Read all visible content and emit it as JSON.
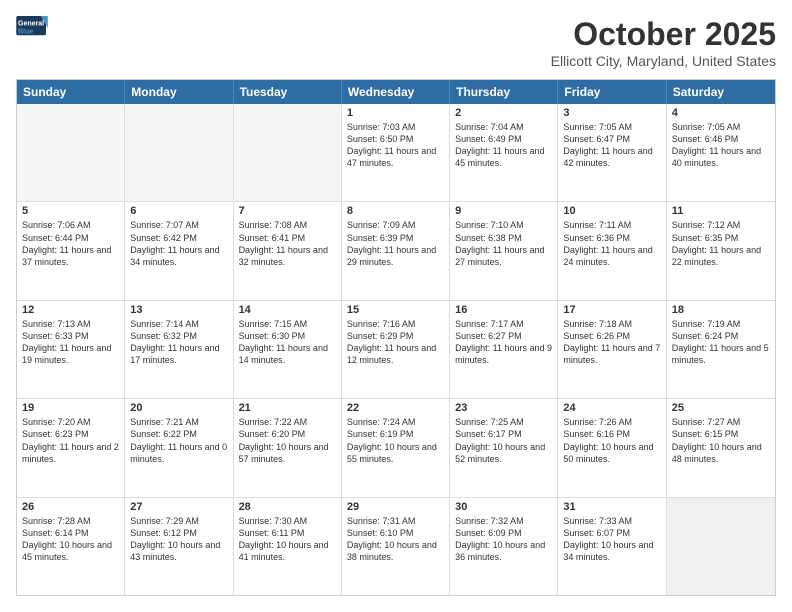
{
  "logo": {
    "line1": "General",
    "line2": "Blue"
  },
  "title": "October 2025",
  "location": "Ellicott City, Maryland, United States",
  "weekdays": [
    "Sunday",
    "Monday",
    "Tuesday",
    "Wednesday",
    "Thursday",
    "Friday",
    "Saturday"
  ],
  "weeks": [
    [
      {
        "day": "",
        "text": "",
        "empty": true
      },
      {
        "day": "",
        "text": "",
        "empty": true
      },
      {
        "day": "",
        "text": "",
        "empty": true
      },
      {
        "day": "1",
        "text": "Sunrise: 7:03 AM\nSunset: 6:50 PM\nDaylight: 11 hours and 47 minutes."
      },
      {
        "day": "2",
        "text": "Sunrise: 7:04 AM\nSunset: 6:49 PM\nDaylight: 11 hours and 45 minutes."
      },
      {
        "day": "3",
        "text": "Sunrise: 7:05 AM\nSunset: 6:47 PM\nDaylight: 11 hours and 42 minutes."
      },
      {
        "day": "4",
        "text": "Sunrise: 7:05 AM\nSunset: 6:46 PM\nDaylight: 11 hours and 40 minutes."
      }
    ],
    [
      {
        "day": "5",
        "text": "Sunrise: 7:06 AM\nSunset: 6:44 PM\nDaylight: 11 hours and 37 minutes."
      },
      {
        "day": "6",
        "text": "Sunrise: 7:07 AM\nSunset: 6:42 PM\nDaylight: 11 hours and 34 minutes."
      },
      {
        "day": "7",
        "text": "Sunrise: 7:08 AM\nSunset: 6:41 PM\nDaylight: 11 hours and 32 minutes."
      },
      {
        "day": "8",
        "text": "Sunrise: 7:09 AM\nSunset: 6:39 PM\nDaylight: 11 hours and 29 minutes."
      },
      {
        "day": "9",
        "text": "Sunrise: 7:10 AM\nSunset: 6:38 PM\nDaylight: 11 hours and 27 minutes."
      },
      {
        "day": "10",
        "text": "Sunrise: 7:11 AM\nSunset: 6:36 PM\nDaylight: 11 hours and 24 minutes."
      },
      {
        "day": "11",
        "text": "Sunrise: 7:12 AM\nSunset: 6:35 PM\nDaylight: 11 hours and 22 minutes."
      }
    ],
    [
      {
        "day": "12",
        "text": "Sunrise: 7:13 AM\nSunset: 6:33 PM\nDaylight: 11 hours and 19 minutes."
      },
      {
        "day": "13",
        "text": "Sunrise: 7:14 AM\nSunset: 6:32 PM\nDaylight: 11 hours and 17 minutes."
      },
      {
        "day": "14",
        "text": "Sunrise: 7:15 AM\nSunset: 6:30 PM\nDaylight: 11 hours and 14 minutes."
      },
      {
        "day": "15",
        "text": "Sunrise: 7:16 AM\nSunset: 6:29 PM\nDaylight: 11 hours and 12 minutes."
      },
      {
        "day": "16",
        "text": "Sunrise: 7:17 AM\nSunset: 6:27 PM\nDaylight: 11 hours and 9 minutes."
      },
      {
        "day": "17",
        "text": "Sunrise: 7:18 AM\nSunset: 6:26 PM\nDaylight: 11 hours and 7 minutes."
      },
      {
        "day": "18",
        "text": "Sunrise: 7:19 AM\nSunset: 6:24 PM\nDaylight: 11 hours and 5 minutes."
      }
    ],
    [
      {
        "day": "19",
        "text": "Sunrise: 7:20 AM\nSunset: 6:23 PM\nDaylight: 11 hours and 2 minutes."
      },
      {
        "day": "20",
        "text": "Sunrise: 7:21 AM\nSunset: 6:22 PM\nDaylight: 11 hours and 0 minutes."
      },
      {
        "day": "21",
        "text": "Sunrise: 7:22 AM\nSunset: 6:20 PM\nDaylight: 10 hours and 57 minutes."
      },
      {
        "day": "22",
        "text": "Sunrise: 7:24 AM\nSunset: 6:19 PM\nDaylight: 10 hours and 55 minutes."
      },
      {
        "day": "23",
        "text": "Sunrise: 7:25 AM\nSunset: 6:17 PM\nDaylight: 10 hours and 52 minutes."
      },
      {
        "day": "24",
        "text": "Sunrise: 7:26 AM\nSunset: 6:16 PM\nDaylight: 10 hours and 50 minutes."
      },
      {
        "day": "25",
        "text": "Sunrise: 7:27 AM\nSunset: 6:15 PM\nDaylight: 10 hours and 48 minutes."
      }
    ],
    [
      {
        "day": "26",
        "text": "Sunrise: 7:28 AM\nSunset: 6:14 PM\nDaylight: 10 hours and 45 minutes."
      },
      {
        "day": "27",
        "text": "Sunrise: 7:29 AM\nSunset: 6:12 PM\nDaylight: 10 hours and 43 minutes."
      },
      {
        "day": "28",
        "text": "Sunrise: 7:30 AM\nSunset: 6:11 PM\nDaylight: 10 hours and 41 minutes."
      },
      {
        "day": "29",
        "text": "Sunrise: 7:31 AM\nSunset: 6:10 PM\nDaylight: 10 hours and 38 minutes."
      },
      {
        "day": "30",
        "text": "Sunrise: 7:32 AM\nSunset: 6:09 PM\nDaylight: 10 hours and 36 minutes."
      },
      {
        "day": "31",
        "text": "Sunrise: 7:33 AM\nSunset: 6:07 PM\nDaylight: 10 hours and 34 minutes."
      },
      {
        "day": "",
        "text": "",
        "empty": true,
        "shaded": true
      }
    ]
  ]
}
